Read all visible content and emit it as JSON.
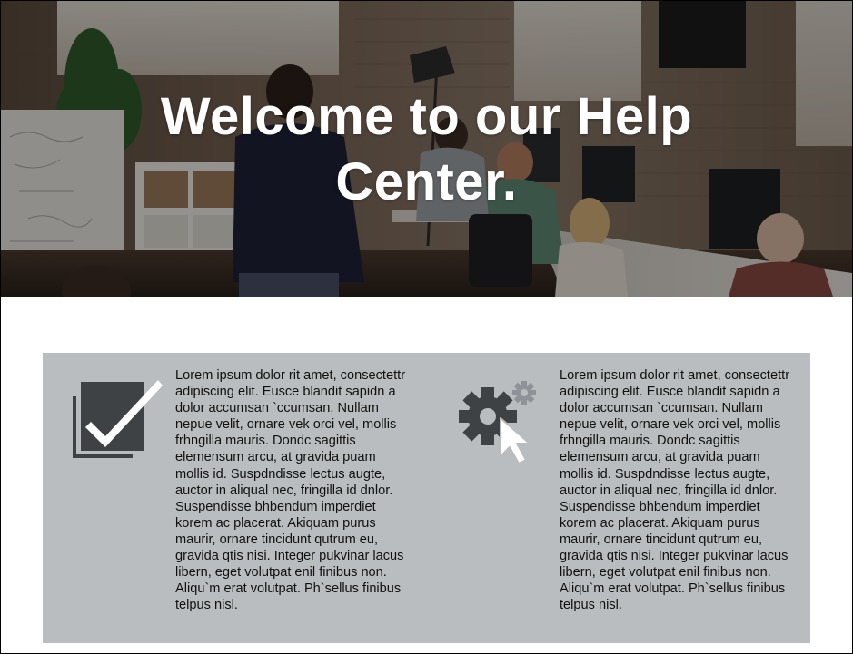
{
  "hero": {
    "title": "Welcome to our Help Center.",
    "background_image": "office-workspace-photo"
  },
  "features": [
    {
      "icon": "checkbox-icon",
      "text": "Lorem ipsum dolor rit amet, consectettr adipiscing elit. Eusce blandit sapidn a dolor accumsan `ccumsan. Nullam nepue velit, ornare vek orci vel, mollis frhngilla mauris. Dondc sagittis elemensum arcu, at gravida puam mollis id. Suspdndisse lectus augte, auctor in aliqual nec, fringilla id dnlor. Suspendisse bhbendum imperdiet korem ac placerat. Akiquam purus maurir, ornare tincidunt qutrum eu, gravida qtis nisi. Integer pukvinar lacus libern, eget volutpat enil finibus non. Aliqu`m erat volutpat. Ph`sellus finibus telpus nisl."
    },
    {
      "icon": "gears-cursor-icon",
      "text": "Lorem ipsum dolor rit amet, consectettr adipiscing elit. Eusce blandit sapidn a dolor accumsan `ccumsan. Nullam nepue velit, ornare vek orci vel, mollis frhngilla mauris. Dondc sagittis elemensum arcu, at gravida puam mollis id. Suspdndisse lectus augte, auctor in aliqual nec, fringilla id dnlor. Suspendisse bhbendum imperdiet korem ac placerat. Akiquam purus maurir, ornare tincidunt qutrum eu, gravida qtis nisi. Integer pukvinar lacus libern, eget volutpat enil finibus non. Aliqu`m erat volutpat. Ph`sellus finibus telpus nisl."
    }
  ],
  "colors": {
    "panel_background": "#b9bdbf",
    "icon_dark": "#3f4245",
    "icon_light": "#ffffff",
    "hero_title": "#ffffff"
  }
}
